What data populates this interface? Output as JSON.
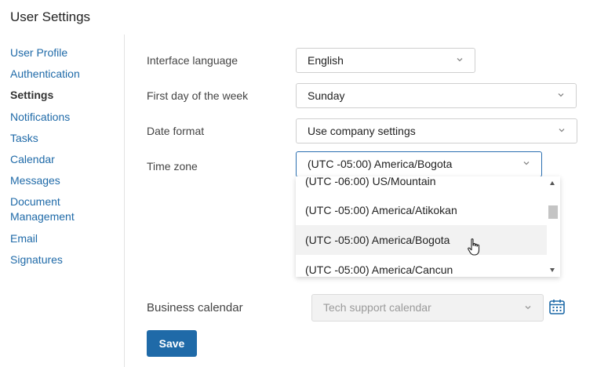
{
  "page": {
    "title": "User Settings"
  },
  "sidebar": {
    "items": [
      {
        "label": "User Profile"
      },
      {
        "label": "Authentication"
      },
      {
        "label": "Settings"
      },
      {
        "label": "Notifications"
      },
      {
        "label": "Tasks"
      },
      {
        "label": "Calendar"
      },
      {
        "label": "Messages"
      },
      {
        "label": "Document Management"
      },
      {
        "label": "Email"
      },
      {
        "label": "Signatures"
      }
    ],
    "active_index": 2
  },
  "form": {
    "interface_language": {
      "label": "Interface language",
      "value": "English"
    },
    "first_day": {
      "label": "First day of the week",
      "value": "Sunday"
    },
    "date_format": {
      "label": "Date format",
      "value": "Use company settings"
    },
    "time_zone": {
      "label": "Time zone",
      "value": "(UTC -05:00) America/Bogota",
      "options": [
        "(UTC -06:00) US/Mountain",
        "(UTC -05:00) America/Atikokan",
        "(UTC -05:00) America/Bogota",
        "(UTC -05:00) America/Cancun"
      ],
      "hovered_option": "(UTC -05:00) America/Bogota"
    },
    "business_calendar": {
      "label": "Business calendar",
      "value": "Tech support calendar",
      "disabled": true
    }
  },
  "actions": {
    "save_label": "Save"
  },
  "colors": {
    "accent": "#1f6aa8",
    "focus_border": "#2a6fb0",
    "hover_bg": "#f2f2f2"
  },
  "icons": {
    "chevron": "chevron-down-icon",
    "calendar": "calendar-icon",
    "cursor": "hand-pointer-icon"
  }
}
